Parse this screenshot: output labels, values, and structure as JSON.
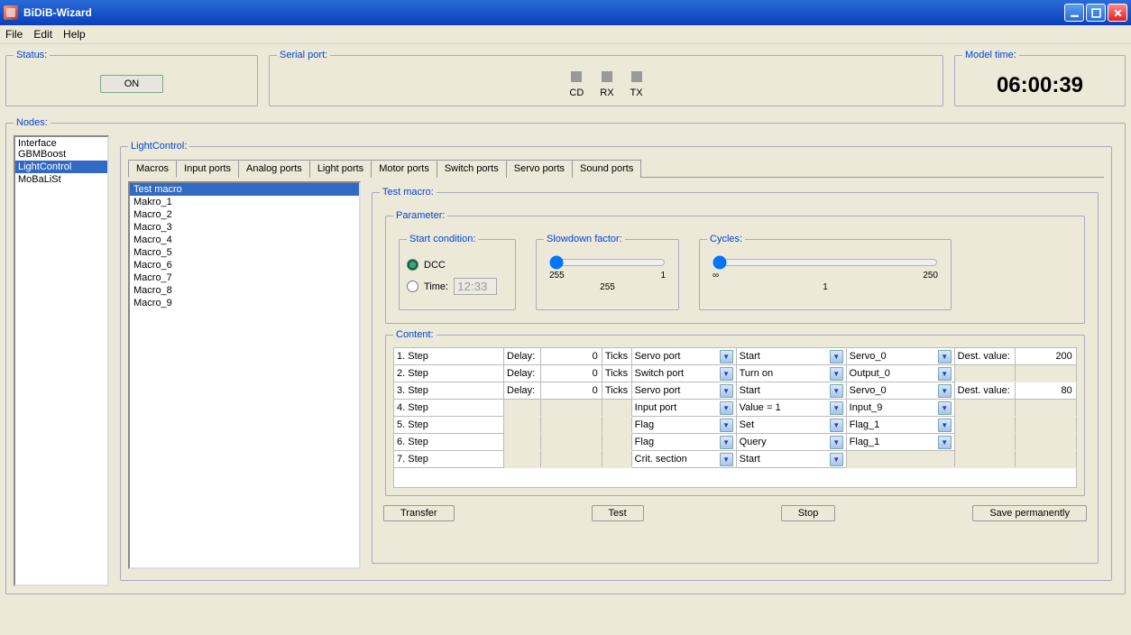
{
  "window": {
    "title": "BiDiB-Wizard"
  },
  "menu": {
    "file": "File",
    "edit": "Edit",
    "help": "Help"
  },
  "status": {
    "legend": "Status:",
    "button": "ON"
  },
  "serial": {
    "legend": "Serial port:",
    "cd": "CD",
    "rx": "RX",
    "tx": "TX"
  },
  "modeltime": {
    "legend": "Model time:",
    "value": "06:00:39"
  },
  "nodes": {
    "legend": "Nodes:",
    "items": [
      "Interface GBMBoost",
      "LightControl",
      "MoBaLiSt"
    ],
    "selected": 1
  },
  "lightcontrol": {
    "legend": "LightControl:"
  },
  "tabs": {
    "items": [
      "Macros",
      "Input ports",
      "Analog ports",
      "Light ports",
      "Motor ports",
      "Switch ports",
      "Servo ports",
      "Sound ports"
    ],
    "active": 0
  },
  "macros": {
    "items": [
      "Test macro",
      "Makro_1",
      "Macro_2",
      "Macro_3",
      "Macro_4",
      "Macro_5",
      "Macro_6",
      "Macro_7",
      "Macro_8",
      "Macro_9"
    ],
    "selected": 0
  },
  "macroDetail": {
    "legend": "Test macro:",
    "parameter": "Parameter:",
    "startCond": {
      "legend": "Start condition:",
      "dcc": "DCC",
      "time": "Time:",
      "timeValue": "12:33"
    },
    "slowdown": {
      "legend": "Slowdown factor:",
      "min": "255",
      "max": "1",
      "value": "255"
    },
    "cycles": {
      "legend": "Cycles:",
      "min": "∞",
      "max": "250",
      "value": "1"
    },
    "content": {
      "legend": "Content:",
      "delayLabel": "Delay:",
      "ticksLabel": "Ticks",
      "destLabel": "Dest. value:",
      "rows": [
        {
          "step": "1. Step",
          "delay": "0",
          "ticks": true,
          "type": "Servo port",
          "action": "Start",
          "target": "Servo_0",
          "dest": "200"
        },
        {
          "step": "2. Step",
          "delay": "0",
          "ticks": true,
          "type": "Switch port",
          "action": "Turn on",
          "target": "Output_0",
          "dest": null
        },
        {
          "step": "3. Step",
          "delay": "0",
          "ticks": true,
          "type": "Servo port",
          "action": "Start",
          "target": "Servo_0",
          "dest": "80"
        },
        {
          "step": "4. Step",
          "delay": null,
          "ticks": false,
          "type": "Input port",
          "action": "Value = 1",
          "target": "Input_9",
          "dest": null
        },
        {
          "step": "5. Step",
          "delay": null,
          "ticks": false,
          "type": "Flag",
          "action": "Set",
          "target": "Flag_1",
          "dest": null
        },
        {
          "step": "6. Step",
          "delay": null,
          "ticks": false,
          "type": "Flag",
          "action": "Query",
          "target": "Flag_1",
          "dest": null
        },
        {
          "step": "7. Step",
          "delay": null,
          "ticks": false,
          "type": "Crit. section",
          "action": "Start",
          "target": null,
          "dest": null
        }
      ]
    },
    "buttons": {
      "transfer": "Transfer",
      "test": "Test",
      "stop": "Stop",
      "save": "Save permanently"
    }
  }
}
